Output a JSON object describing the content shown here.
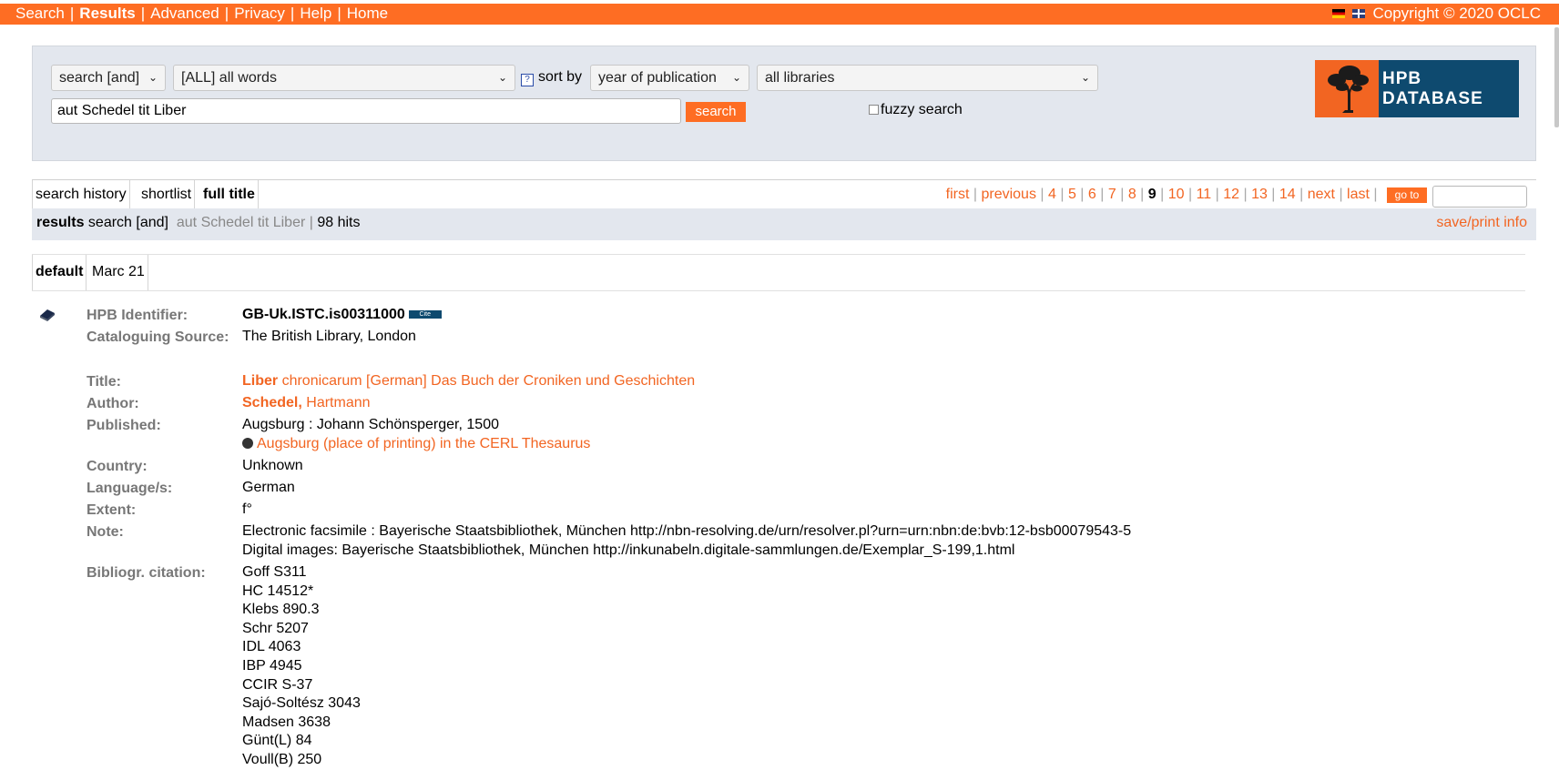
{
  "topnav": {
    "items": [
      "Search",
      "Results",
      "Advanced",
      "Privacy",
      "Help",
      "Home"
    ],
    "active": "Results",
    "copyright": "Copyright © 2020 OCLC"
  },
  "search": {
    "operator": "search [and]",
    "field": "[ALL] all words",
    "help": "?",
    "sort_label": "sort by",
    "sort": "year of publication",
    "libraries": "all libraries",
    "query": "aut Schedel tit Liber",
    "button": "search",
    "fuzzy": "fuzzy search",
    "fuzzy_checked": false
  },
  "logo": {
    "line1": "HPB",
    "line2": "DATABASE"
  },
  "tabs": [
    "search history",
    "shortlist",
    "full title"
  ],
  "pager": {
    "first": "first",
    "previous": "previous",
    "pages": [
      "4",
      "5",
      "6",
      "7",
      "8",
      "9",
      "10",
      "11",
      "12",
      "13",
      "14"
    ],
    "current": "9",
    "next": "next",
    "last": "last",
    "goto": "go to"
  },
  "info": {
    "results": "results",
    "search": "search [and]",
    "query": "aut Schedel tit Liber",
    "hits": "98 hits",
    "save": "save/print info"
  },
  "view_tabs": [
    "default",
    "Marc 21"
  ],
  "record": {
    "hpb_identifier": {
      "label": "HPB Identifier:",
      "value": "GB-Uk.ISTC.is00311000",
      "cite": "Cite"
    },
    "cataloguing_source": {
      "label": "Cataloguing Source:",
      "value": "The British Library, London"
    },
    "title": {
      "label": "Title:",
      "bold": "Liber",
      "rest": " chronicarum [German] Das Buch der Croniken und Geschichten"
    },
    "author": {
      "label": "Author:",
      "bold": "Schedel,",
      "rest": " Hartmann"
    },
    "published": {
      "label": "Published:",
      "value": "Augsburg : Johann Schönsperger, 1500",
      "link": "Augsburg (place of printing) in the CERL Thesaurus"
    },
    "country": {
      "label": "Country:",
      "value": "Unknown"
    },
    "language": {
      "label": "Language/s:",
      "value": "German"
    },
    "extent": {
      "label": "Extent:",
      "value": "f°"
    },
    "note": {
      "label": "Note:",
      "lines": [
        "Electronic facsimile : Bayerische Staatsbibliothek, München http://nbn-resolving.de/urn/resolver.pl?urn=urn:nbn:de:bvb:12-bsb00079543-5",
        "Digital images: Bayerische Staatsbibliothek, München http://inkunabeln.digitale-sammlungen.de/Exemplar_S-199,1.html"
      ]
    },
    "citation": {
      "label": "Bibliogr. citation:",
      "lines": [
        "Goff S311",
        "HC 14512*",
        "Klebs 890.3",
        "Schr 5207",
        "IDL 4063",
        "IBP 4945",
        "CCIR S-37",
        "Sajó-Soltész 3043",
        "Madsen 3638",
        "Günt(L) 84",
        "Voull(B) 250"
      ]
    }
  }
}
